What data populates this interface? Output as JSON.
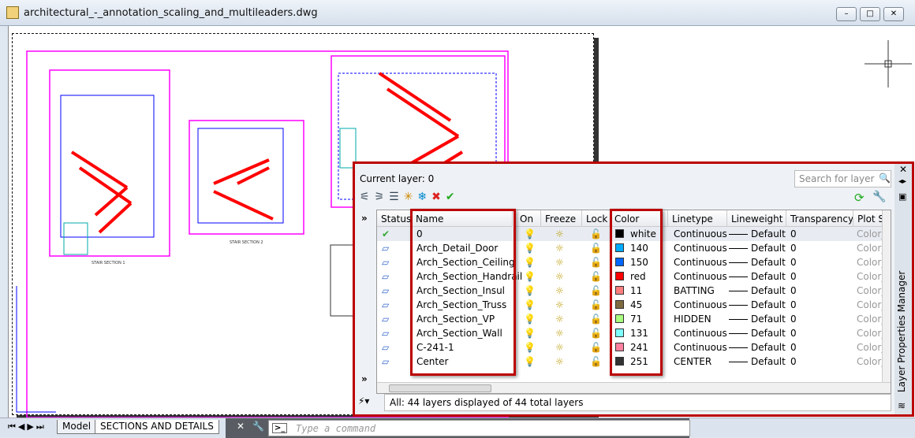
{
  "window": {
    "title": "architectural_-_annotation_scaling_and_multileaders.dwg",
    "min": "–",
    "max": "□",
    "close": "✕"
  },
  "drawing": {
    "label1": "STAIR SECTION 1",
    "label2": "STAIR SECTION 2"
  },
  "tabs": {
    "model": "Model",
    "layout": "SECTIONS AND DETAILS"
  },
  "command": {
    "placeholder": "Type a command"
  },
  "palette": {
    "current_layer": "Current layer: 0",
    "search_placeholder": "Search for layer",
    "side_title": "Layer Properties Manager",
    "status": "All: 44 layers displayed of 44 total layers",
    "columns": [
      "Status",
      "Name",
      "On",
      "Freeze",
      "Lock",
      "Color",
      "Linetype",
      "Lineweight",
      "Transparency",
      "Plot S"
    ],
    "layers": [
      {
        "status": "current",
        "name": "0",
        "color": "white",
        "swatch": "#000000",
        "linetype": "Continuous",
        "lineweight": "Default",
        "transparency": "0",
        "plot": "Color_"
      },
      {
        "status": "layer",
        "name": "Arch_Detail_Door",
        "color": "140",
        "swatch": "#00aaff",
        "linetype": "Continuous",
        "lineweight": "Default",
        "transparency": "0",
        "plot": "Color_"
      },
      {
        "status": "layer",
        "name": "Arch_Section_Ceiling",
        "color": "150",
        "swatch": "#0066ff",
        "linetype": "Continuous",
        "lineweight": "Default",
        "transparency": "0",
        "plot": "Color_"
      },
      {
        "status": "layer",
        "name": "Arch_Section_Handrail",
        "color": "red",
        "swatch": "#ff0000",
        "linetype": "Continuous",
        "lineweight": "Default",
        "transparency": "0",
        "plot": "Color_"
      },
      {
        "status": "layer",
        "name": "Arch_Section_Insul",
        "color": "11",
        "swatch": "#ff7f7f",
        "linetype": "BATTING",
        "lineweight": "Default",
        "transparency": "0",
        "plot": "Color_"
      },
      {
        "status": "layer",
        "name": "Arch_Section_Truss",
        "color": "45",
        "swatch": "#7f6a3f",
        "linetype": "Continuous",
        "lineweight": "Default",
        "transparency": "0",
        "plot": "Color_"
      },
      {
        "status": "layer",
        "name": "Arch_Section_VP",
        "color": "71",
        "swatch": "#aaff7f",
        "linetype": "HIDDEN",
        "lineweight": "Default",
        "transparency": "0",
        "plot": "Color_"
      },
      {
        "status": "layer",
        "name": "Arch_Section_Wall",
        "color": "131",
        "swatch": "#7fffff",
        "linetype": "Continuous",
        "lineweight": "Default",
        "transparency": "0",
        "plot": "Color_"
      },
      {
        "status": "layer",
        "name": "C-241-1",
        "color": "241",
        "swatch": "#ff7f9f",
        "linetype": "Continuous",
        "lineweight": "Default",
        "transparency": "0",
        "plot": "Color_"
      },
      {
        "status": "layer",
        "name": "Center",
        "color": "251",
        "swatch": "#333333",
        "linetype": "CENTER",
        "lineweight": "Default",
        "transparency": "0",
        "plot": "Color_"
      }
    ]
  },
  "colors": {
    "highlight": "#b00000",
    "viewport": "#ff00ff"
  }
}
